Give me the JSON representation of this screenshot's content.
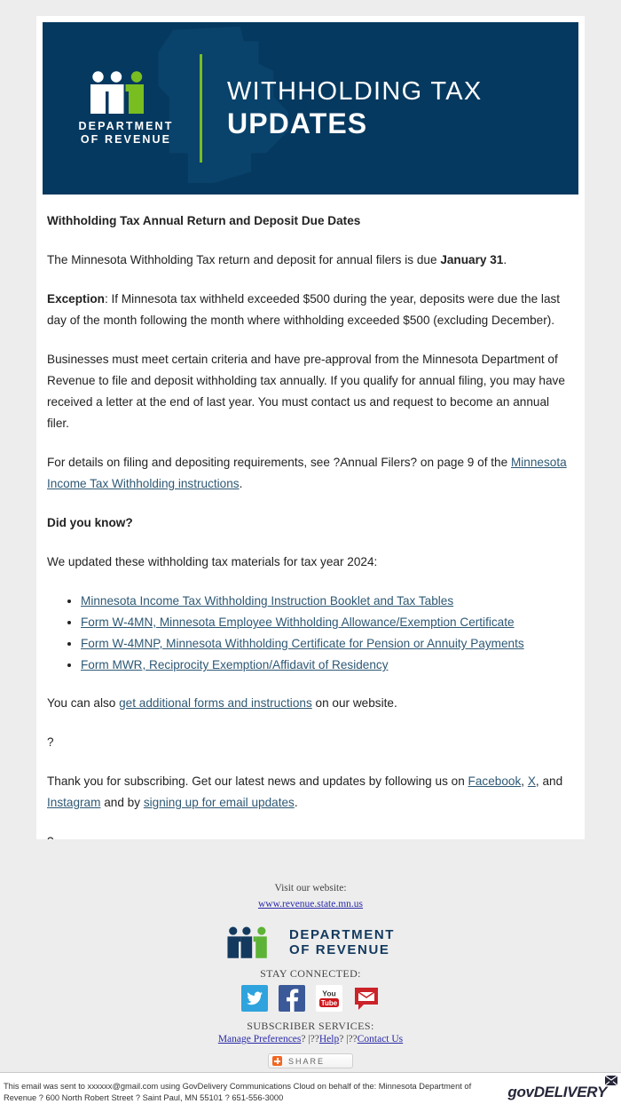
{
  "banner": {
    "logo_mark": "mn-logo-icon",
    "dept_line1": "DEPARTMENT",
    "dept_line2": "OF REVENUE",
    "title_line1": "WITHHOLDING TAX",
    "title_line2": "UPDATES",
    "bg_color": "#06395f",
    "accent_color": "#78be21"
  },
  "body": {
    "heading": "Withholding Tax Annual Return and Deposit Due Dates",
    "p1_a": "The Minnesota Withholding Tax return and deposit for annual filers is due ",
    "p1_b": "January 31",
    "p1_c": ".",
    "p2_label": "Exception",
    "p2_text": ": If Minnesota tax withheld exceeded $500 during the year, deposits were due the last day of the month following the month where withholding exceeded $500 (excluding December).",
    "p3": "Businesses must meet certain criteria and have pre-approval from the Minnesota Department of Revenue to file and deposit withholding tax annually. If you qualify for annual filing, you may have received a letter at the end of last year. You must contact us and request to become an annual filer.",
    "p4_a": "For details on filing and depositing requirements, see ?Annual Filers? on page 9 of the ",
    "p4_link": "Minnesota Income Tax Withholding instructions",
    "p4_b": ".",
    "did_you_know": "Did you know?",
    "p5": "We updated these withholding tax materials for tax year 2024:",
    "bullets": [
      "Minnesota Income Tax Withholding Instruction Booklet and Tax Tables",
      "Form W-4MN, Minnesota Employee Withholding Allowance/Exemption Certificate",
      "Form W-4MNP, Minnesota Withholding Certificate for Pension or Annuity Payments",
      "Form MWR, Reciprocity Exemption/Affidavit of Residency"
    ],
    "p6_a": "You can also ",
    "p6_link": "get additional forms and instructions",
    "p6_b": " on our website.",
    "spacer1": "?",
    "p7_a": "Thank you for subscribing. Get our latest news and updates by following us on ",
    "p7_facebook": "Facebook",
    "p7_b": ", ",
    "p7_x": "X",
    "p7_c": ", and ",
    "p7_instagram": "Instagram",
    "p7_d": " and by ",
    "p7_signup": "signing up for email updates",
    "p7_e": ".",
    "spacer2": "?",
    "link_color": "#2e5874"
  },
  "footer": {
    "visit_label": "Visit our website:",
    "visit_url": "www.revenue.state.mn.us",
    "dept_line1": "DEPARTMENT",
    "dept_line2": "OF REVENUE",
    "stay_connected": "STAY CONNECTED:",
    "social": [
      {
        "name": "twitter-icon",
        "label": "Twitter",
        "color": "#2fa3dd"
      },
      {
        "name": "facebook-icon",
        "label": "Facebook",
        "color": "#3b5998"
      },
      {
        "name": "youtube-icon",
        "label": "YouTube",
        "color": "#cc181e"
      },
      {
        "name": "email-icon",
        "label": "Email",
        "color": "#cc2229"
      }
    ],
    "subscriber_head": "SUBSCRIBER SERVICES:",
    "manage_preferences": "Manage Preferences",
    "sep1": "? |??",
    "help": "Help",
    "sep2": "? |??",
    "contact_us": "Contact Us",
    "share_label": "SHARE",
    "link_color": "#2a2aa8"
  },
  "bottom": {
    "text_line1": "This email was sent to xxxxxx@gmail.com using GovDelivery Communications Cloud on behalf of the: Minnesota Department of",
    "text_line2": "Revenue ? 600 North Robert Street ? Saint Paul, MN 55101 ? 651-556-3000",
    "brand_gov": "gov",
    "brand_delivery": "DELIVERY"
  }
}
